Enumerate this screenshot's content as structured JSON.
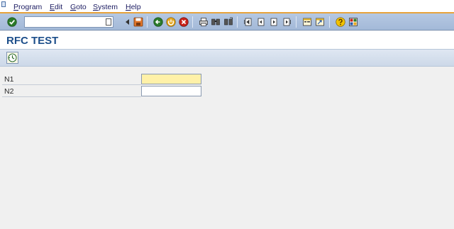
{
  "menu": {
    "items": [
      {
        "first": "P",
        "rest": "rogram"
      },
      {
        "first": "E",
        "rest": "dit"
      },
      {
        "first": "G",
        "rest": "oto"
      },
      {
        "first": "S",
        "rest": "ystem"
      },
      {
        "first": "H",
        "rest": "elp"
      }
    ]
  },
  "toolbar": {
    "command_field_value": ""
  },
  "screen": {
    "title": "RFC TEST"
  },
  "form": {
    "fields": [
      {
        "label": "N1",
        "value": ""
      },
      {
        "label": "N2",
        "value": ""
      }
    ]
  },
  "colors": {
    "title_text": "#1c4e8a",
    "menu_accent": "#e8a33c",
    "toolbar_bg": "#b5c8e2",
    "focused_input_bg": "#fff1a8"
  }
}
